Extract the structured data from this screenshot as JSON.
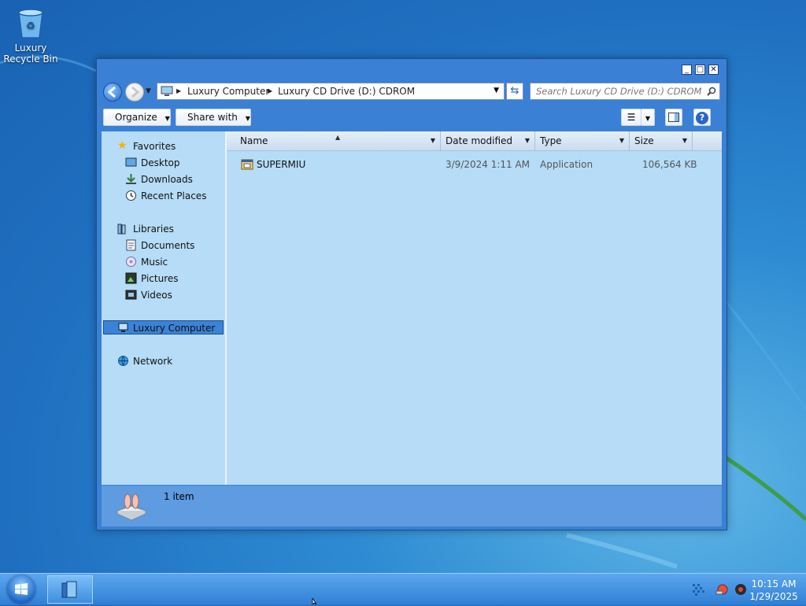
{
  "desktop": {
    "recycle_bin_label": "Luxury Recycle Bin"
  },
  "window": {
    "controls": {
      "minimize": "_",
      "maximize": "□",
      "close": "✕"
    },
    "address": {
      "segments": [
        "Luxury Computer",
        "Luxury CD Drive (D:) CDROM"
      ]
    },
    "search": {
      "placeholder": "Search Luxury CD Drive (D:) CDROM"
    },
    "toolbar": {
      "organize": "Organize",
      "share_with": "Share with"
    },
    "nav": {
      "favorites": "Favorites",
      "desktop": "Desktop",
      "downloads": "Downloads",
      "recent_places": "Recent Places",
      "libraries": "Libraries",
      "documents": "Documents",
      "music": "Music",
      "pictures": "Pictures",
      "videos": "Videos",
      "computer": "Luxury Computer",
      "network": "Network"
    },
    "columns": {
      "name": "Name",
      "date_modified": "Date modified",
      "type": "Type",
      "size": "Size"
    },
    "files": [
      {
        "name": "SUPERMIU",
        "date": "3/9/2024 1:11 AM",
        "type": "Application",
        "size": "106,564 KB"
      }
    ],
    "status": {
      "count": "1 item"
    }
  },
  "taskbar": {
    "time": "10:15 AM",
    "date": "1/29/2025"
  },
  "colors": {
    "desktop": "#2e8bd2",
    "window_frame": "#3a80d4",
    "pane": "#b6dcf7",
    "selection": "#3b83d6",
    "details_pane": "#5e9be0"
  }
}
